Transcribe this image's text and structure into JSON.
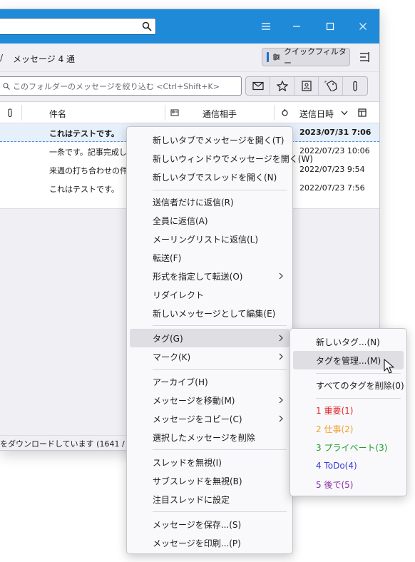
{
  "window": {
    "search_value": "",
    "toolbar_label": "メッセージ 4 通",
    "quick_filter_label": "クイックフィルター",
    "filter_placeholder": "このフォルダーのメッセージを絞り込む <Ctrl+Shift+K>",
    "filter_buttons": [
      "envelope-icon",
      "star-icon",
      "contact-card-icon",
      "tag-icon",
      "paperclip-icon"
    ]
  },
  "columns": {
    "subject": "件名",
    "correspondent": "通信相手",
    "date": "送信日時"
  },
  "messages": [
    {
      "subject": "これはテストです。",
      "date": "2023/07/31 7:06",
      "selected": true
    },
    {
      "subject": "一条です。記事完成し",
      "date": "2022/07/23 10:06",
      "selected": false
    },
    {
      "subject": "来週の打ち合わせの件",
      "date": "2022/07/23 9:54",
      "selected": false
    },
    {
      "subject": "これはテストです。",
      "date": "2022/07/23 7:56",
      "selected": false
    }
  ],
  "status_text": "をダウンロードしています (1641 / 2262",
  "context_menu": {
    "groups": [
      [
        "新しいタブでメッセージを開く(T)",
        "新しいウィンドウでメッセージを開く(W)",
        "新しいタブでスレッドを開く(N)"
      ],
      [
        "送信者だけに返信(R)",
        "全員に返信(A)",
        "メーリングリストに返信(L)",
        "転送(F)",
        "形式を指定して転送(O)",
        "リダイレクト",
        "新しいメッセージとして編集(E)"
      ],
      [
        "タグ(G)",
        "マーク(K)"
      ],
      [
        "アーカイブ(H)",
        "メッセージを移動(M)",
        "メッセージをコピー(C)",
        "選択したメッセージを削除"
      ],
      [
        "スレッドを無視(I)",
        "サブスレッドを無視(B)",
        "注目スレッドに設定"
      ],
      [
        "メッセージを保存...(S)",
        "メッセージを印刷...(P)"
      ]
    ]
  },
  "tag_submenu": {
    "new_tag": "新しいタグ...(N)",
    "manage_tags": "タグを管理...(M)",
    "remove_all": "すべてのタグを削除(0)",
    "tags": [
      {
        "label": "1 重要(1)",
        "color": "#e0262b"
      },
      {
        "label": "2 仕事(2)",
        "color": "#f0a030"
      },
      {
        "label": "3 プライベート(3)",
        "color": "#1f9e2c"
      },
      {
        "label": "4 ToDo(4)",
        "color": "#3a3ad8"
      },
      {
        "label": "5 後で(5)",
        "color": "#8a2da8"
      }
    ]
  },
  "colors": {
    "titlebar": "#1f8ad8",
    "menu_highlight": "#dedee3"
  }
}
